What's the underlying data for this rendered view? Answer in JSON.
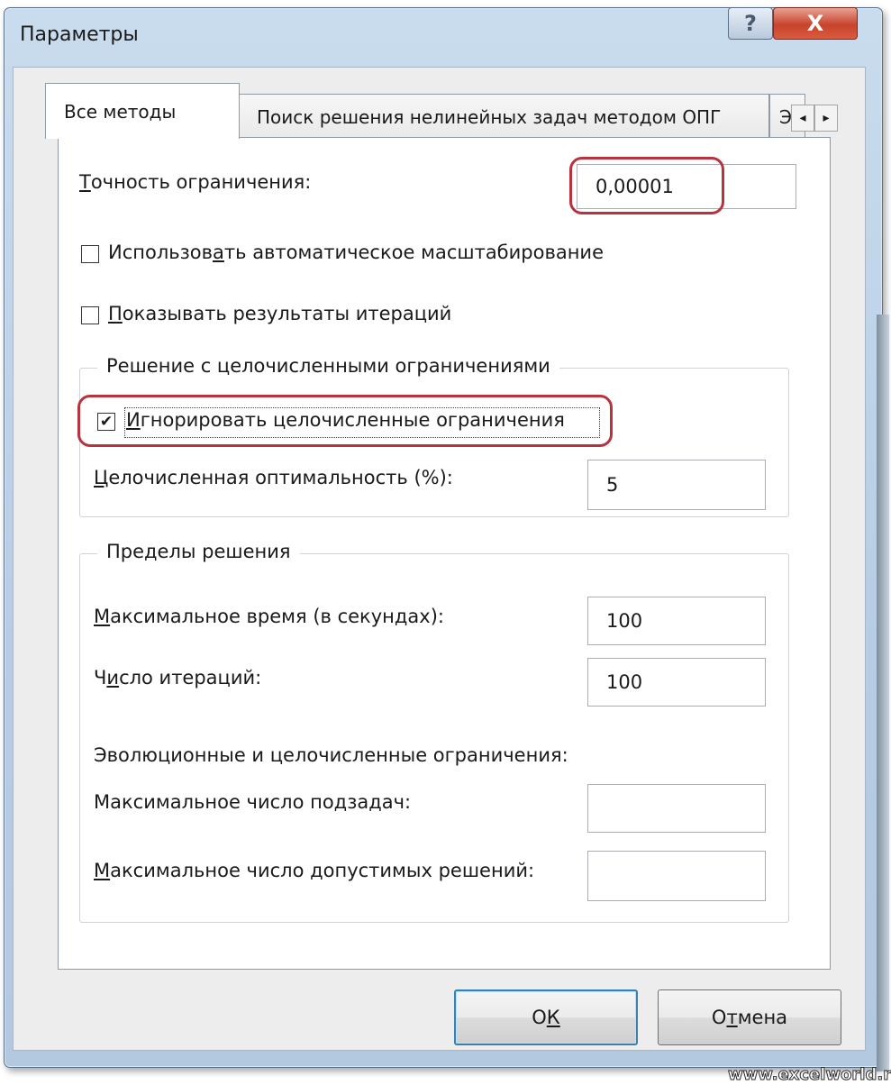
{
  "window": {
    "title": "Параметры",
    "help_icon": "?",
    "close_icon": "X"
  },
  "tabs": [
    {
      "label": "Все методы",
      "active": true
    },
    {
      "label": "Поиск решения нелинейных задач методом ОПГ",
      "active": false
    },
    {
      "label": "Э",
      "active": false
    }
  ],
  "tab_scroll": {
    "left": "◂",
    "right": "▸"
  },
  "constraint_precision": {
    "label_prefix": "Т",
    "label_rest": "очность ограничения:",
    "value": "0,00001"
  },
  "auto_scaling": {
    "label_pre": "Использов",
    "label_u": "а",
    "label_post": "ть автоматическое масштабирование",
    "checked": false
  },
  "show_iterations": {
    "label_u": "П",
    "label_rest": "оказывать результаты итераций",
    "checked": false
  },
  "integer_group": {
    "title": "Решение с целочисленными ограничениями",
    "ignore": {
      "label_u": "И",
      "label_rest": "гнорировать целочисленные ограничения",
      "checked": true,
      "check_glyph": "✔"
    },
    "optimality": {
      "label_u": "Ц",
      "label_rest": "елочисленная оптимальность (%):",
      "value": "5"
    }
  },
  "limits_group": {
    "title": "Пределы решения",
    "max_time": {
      "label_u": "М",
      "label_rest": "аксимальное время (в секундах):",
      "value": "100"
    },
    "iterations": {
      "label_pre": "Ч",
      "label_u": "и",
      "label_rest": "сло итераций:",
      "value": "100"
    },
    "evolutionary_title": "Эволюционные и целочисленные ограничения:",
    "max_subproblems": {
      "label": "Максимальное число подзадач:",
      "value": ""
    },
    "max_feasible": {
      "label_u": "М",
      "label_rest": "аксимальное число допустимых решений:",
      "value": ""
    }
  },
  "buttons": {
    "ok_pre": "О",
    "ok_u": "К",
    "cancel_pre": "О",
    "cancel_u": "т",
    "cancel_post": "мена"
  },
  "watermark": "www.excelworld.ru",
  "colors": {
    "highlight": "#b8333e",
    "close_button": "#c8432c",
    "default_button_border": "#3c7fb1"
  }
}
